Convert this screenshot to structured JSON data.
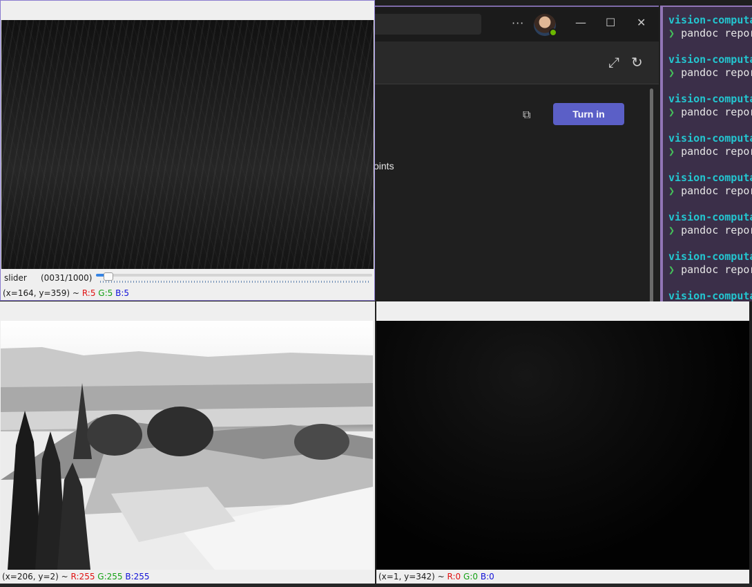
{
  "teams": {
    "more_glyph": "···",
    "minimize_glyph": "—",
    "maximize_glyph": "☐",
    "close_glyph": "✕",
    "expand_glyph": "⤢",
    "refresh_glyph": "↻",
    "immersive_glyph": "⧉",
    "turn_in_label": "Turn in",
    "points_text": "oints"
  },
  "terminal": {
    "lines": [
      {
        "host": "vision-computa",
        "cmd": "pandoc repor"
      },
      {
        "host": "vision-computa",
        "cmd": "pandoc repor"
      },
      {
        "host": "vision-computa",
        "cmd": "pandoc repor"
      },
      {
        "host": "vision-computa",
        "cmd": "pandoc repor"
      },
      {
        "host": "vision-computa",
        "cmd": "pandoc repor"
      },
      {
        "host": "vision-computa",
        "cmd": "pandoc repor"
      },
      {
        "host": "vision-computa",
        "cmd": "pandoc repor"
      },
      {
        "host": "vision-computa",
        "cmd": ""
      }
    ],
    "prompt_glyph": "❯"
  },
  "win1": {
    "slider_label": "slider",
    "slider_count": "(0031/1000)",
    "slider_fraction": 0.031,
    "status_coords": "(x=164, y=359) ~",
    "r": "R:5",
    "g": "G:5",
    "b": "B:5"
  },
  "win2": {
    "status_coords": "(x=206, y=2) ~",
    "r": "R:255",
    "g": "G:255",
    "b": "B:255"
  },
  "win3": {
    "status_coords": "(x=1, y=342) ~",
    "r": "R:0",
    "g": "G:0",
    "b": "B:0"
  },
  "colors": {
    "accent": "#5b5fc7",
    "terminal_host": "#23c6d0",
    "terminal_prompt": "#44c35a",
    "slider_fill": "#3584e4"
  }
}
